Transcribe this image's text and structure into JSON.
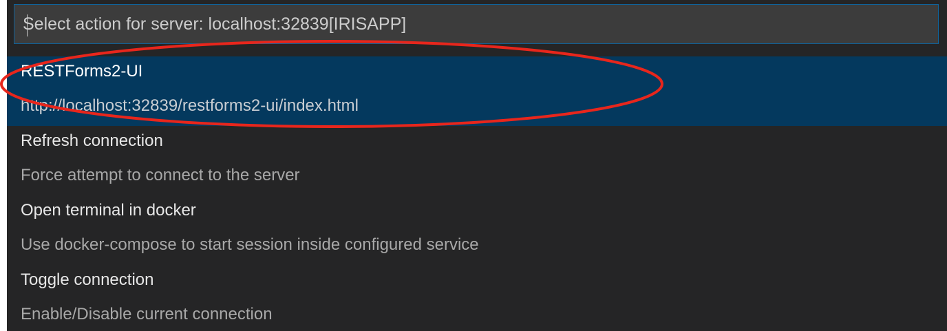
{
  "quick_pick": {
    "placeholder": "Select action for server: localhost:32839[IRISAPP]",
    "value": ""
  },
  "items": [
    {
      "label": "RESTForms2-UI",
      "detail": "http://localhost:32839/restforms2-ui/index.html",
      "selected": true
    },
    {
      "label": "Refresh connection",
      "detail": "Force attempt to connect to the server",
      "selected": false
    },
    {
      "label": "Open terminal in docker",
      "detail": "Use docker-compose to start session inside configured service",
      "selected": false
    },
    {
      "label": "Toggle connection",
      "detail": "Enable/Disable current connection",
      "selected": false
    }
  ],
  "colors": {
    "background": "#252526",
    "selected_row": "#04395e",
    "input_background": "#3c3c3c",
    "input_border": "#0e639c",
    "annotation_ellipse": "#e8261c"
  }
}
